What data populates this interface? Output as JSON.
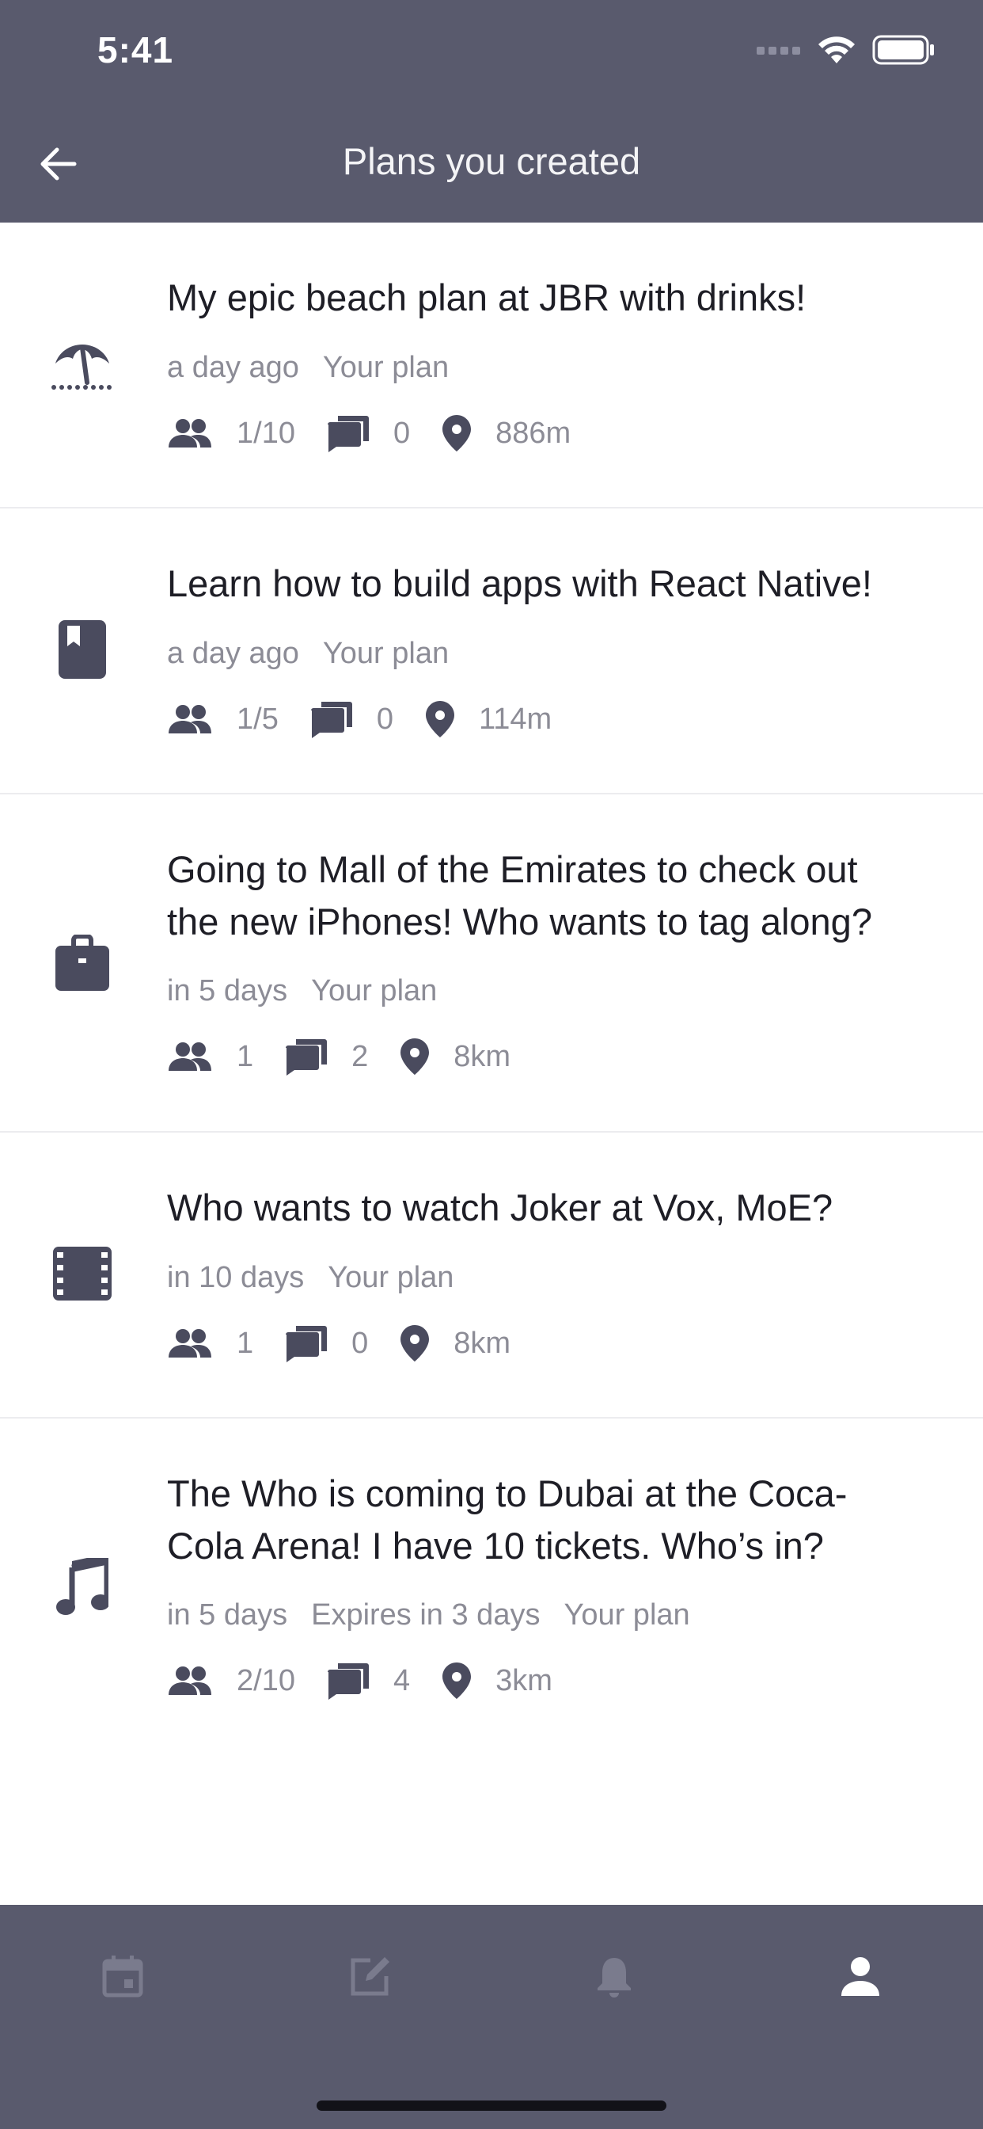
{
  "status_bar": {
    "time": "5:41"
  },
  "nav": {
    "title": "Plans you created"
  },
  "plans": [
    {
      "icon": "beach-icon",
      "title": "My epic beach plan at JBR with drinks!",
      "meta": [
        "a day ago",
        "Your plan"
      ],
      "attendees": "1/10",
      "comments": "0",
      "distance": "886m"
    },
    {
      "icon": "book-icon",
      "title": "Learn how to build apps with React Native!",
      "meta": [
        "a day ago",
        "Your plan"
      ],
      "attendees": "1/5",
      "comments": "0",
      "distance": "114m"
    },
    {
      "icon": "shopping-bag-icon",
      "title": "Going to Mall of the Emirates to check out the new iPhones! Who wants to tag along?",
      "meta": [
        "in 5 days",
        "Your plan"
      ],
      "attendees": "1",
      "comments": "2",
      "distance": "8km"
    },
    {
      "icon": "film-icon",
      "title": "Who wants to watch Joker at Vox, MoE?",
      "meta": [
        "in 10 days",
        "Your plan"
      ],
      "attendees": "1",
      "comments": "0",
      "distance": "8km"
    },
    {
      "icon": "music-note-icon",
      "title": "The Who is coming to Dubai at the Coca-Cola Arena! I have 10 tickets. Who’s in?",
      "meta": [
        "in 5 days",
        "Expires in 3 days",
        "Your plan"
      ],
      "attendees": "2/10",
      "comments": "4",
      "distance": "3km"
    }
  ],
  "tabs": [
    {
      "icon": "calendar-icon",
      "active": false
    },
    {
      "icon": "edit-icon",
      "active": false
    },
    {
      "icon": "bell-icon",
      "active": false
    },
    {
      "icon": "profile-icon",
      "active": true
    }
  ],
  "colors": {
    "header": "#595a6d",
    "icon": "#4a4b5e",
    "muted": "#8c8c96",
    "tab_inactive": "#7a7b8d",
    "tab_active": "#ffffff"
  }
}
